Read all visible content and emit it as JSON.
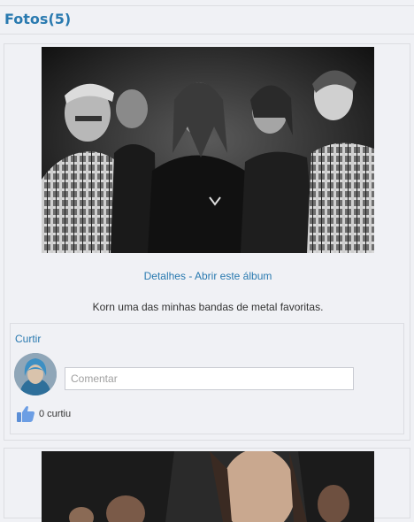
{
  "section": {
    "title": "Fotos(5)"
  },
  "photos": [
    {
      "links": {
        "details": "Detalhes",
        "separator": "-",
        "open_album": "Abrir este álbum"
      },
      "caption": "Korn uma das minhas bandas de metal favoritas.",
      "like_label": "Curtir",
      "comment_placeholder": "Comentar",
      "likes": "0 curtiu"
    }
  ],
  "icons": {
    "like": "thumbs-up-icon",
    "avatar": "user-avatar"
  },
  "colors": {
    "link": "#2a7ab0",
    "background": "#f0f1f5",
    "border": "#dcdde2"
  }
}
